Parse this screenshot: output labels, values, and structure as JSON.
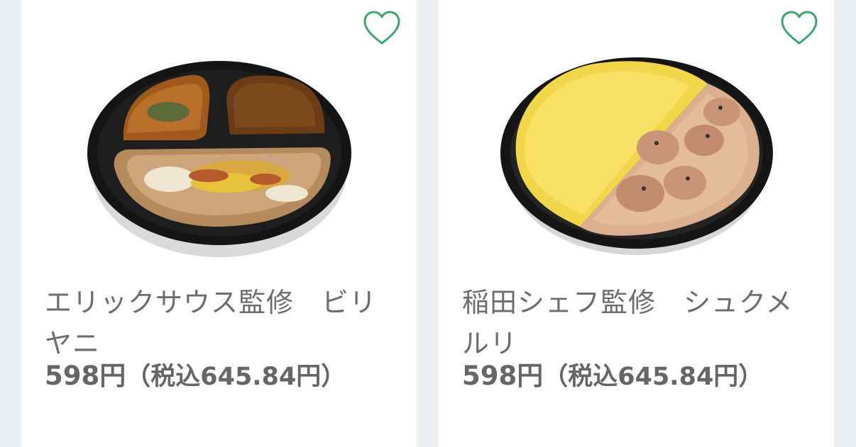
{
  "products": [
    {
      "name": "エリックサウス監修　ビリヤニ",
      "price": "598円",
      "tax_price": "（税込645.84円）",
      "favorite_icon": "heart-outline-icon",
      "image": "biryani-bowl"
    },
    {
      "name": "稲田シェフ監修　シュクメルリ",
      "price": "598円",
      "tax_price": "（税込645.84円）",
      "favorite_icon": "heart-outline-icon",
      "image": "shkmeruli-bowl"
    }
  ],
  "colors": {
    "heart": "#3aa86b",
    "name_text": "#6d6d6d",
    "price_text": "#666666",
    "background": "#edf0f3"
  }
}
